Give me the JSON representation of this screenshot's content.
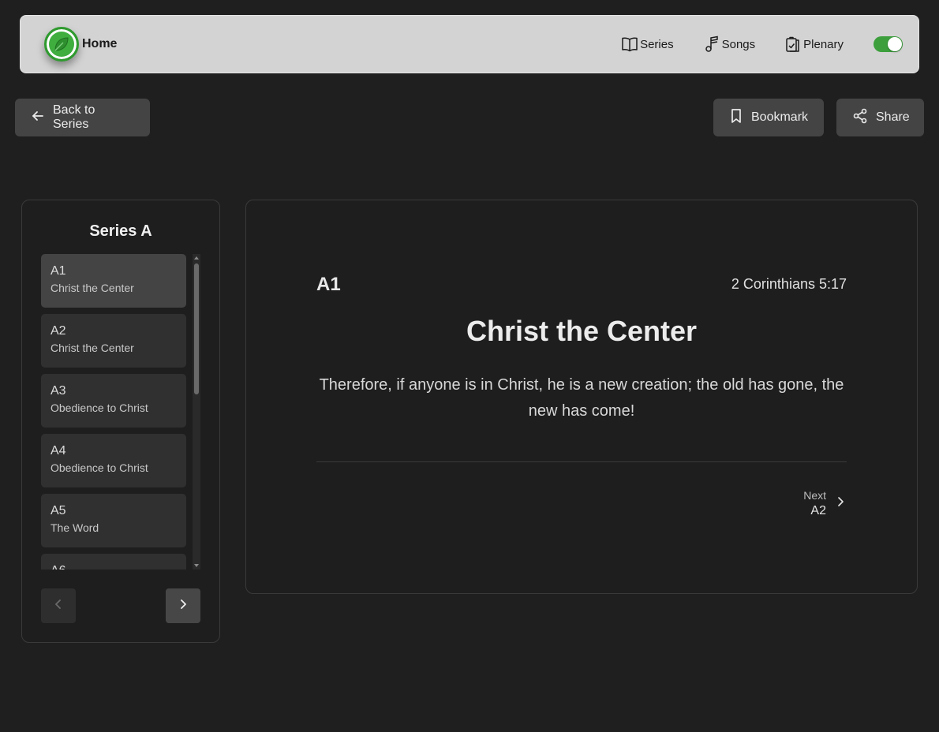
{
  "nav": {
    "brand": "Home",
    "links": [
      {
        "label": "Series",
        "icon": "book-open-icon"
      },
      {
        "label": "Songs",
        "icon": "music-note-icon"
      },
      {
        "label": "Plenary",
        "icon": "clipboard-check-icon"
      }
    ],
    "theme_toggle_on": true,
    "accent_color": "#3fae3f"
  },
  "actions": {
    "back_label": "Back to Series",
    "bookmark_label": "Bookmark",
    "share_label": "Share"
  },
  "sidebar": {
    "title": "Series A",
    "items": [
      {
        "code": "A1",
        "title": "Christ the Center",
        "active": true
      },
      {
        "code": "A2",
        "title": "Christ the Center"
      },
      {
        "code": "A3",
        "title": "Obedience to Christ"
      },
      {
        "code": "A4",
        "title": "Obedience to Christ"
      },
      {
        "code": "A5",
        "title": "The Word"
      },
      {
        "code": "A6",
        "title": ""
      }
    ]
  },
  "card": {
    "code": "A1",
    "reference": "2 Corinthians 5:17",
    "title": "Christ the Center",
    "verse": "Therefore, if anyone is in Christ, he is a new creation; the old has gone, the new has come!",
    "next_label": "Next",
    "next_code": "A2"
  }
}
